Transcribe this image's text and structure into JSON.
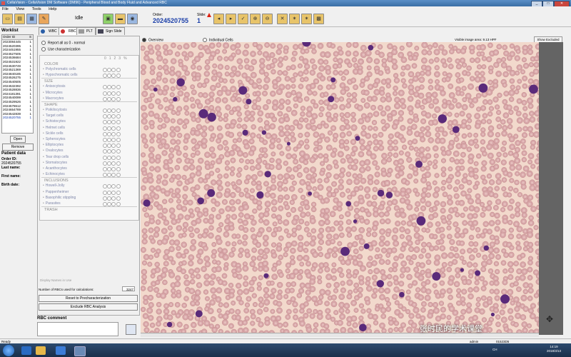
{
  "window": {
    "title": "CellaVision - CellaVision DM Software (DM96) - Peripheral Blood and Body Fluid and Advanced RBC",
    "minimize": "_",
    "maximize": "□",
    "close": "✕"
  },
  "menu": [
    "File",
    "View",
    "Tools",
    "Help"
  ],
  "toolbar": {
    "status": "Idle",
    "order_label": "Order:",
    "order_value": "2024520755",
    "slide_label": "Slide:",
    "slide_value": "1"
  },
  "worklist": {
    "title": "Worklist",
    "col_order": "Order ID",
    "col_s": "S",
    "rows": [
      {
        "id": "2023084445",
        "s": "1"
      },
      {
        "id": "2024520395",
        "s": "1"
      },
      {
        "id": "2024451955",
        "s": "1"
      },
      {
        "id": "2024527505",
        "s": "1"
      },
      {
        "id": "2024536684",
        "s": "1"
      },
      {
        "id": "2024531922",
        "s": "1"
      },
      {
        "id": "2024530749",
        "s": "1"
      },
      {
        "id": "2024521369",
        "s": "1"
      },
      {
        "id": "2024840185",
        "s": "1"
      },
      {
        "id": "2024526275",
        "s": "1"
      },
      {
        "id": "2024540505",
        "s": "1"
      },
      {
        "id": "2024532392",
        "s": "1"
      },
      {
        "id": "2024528836",
        "s": "1"
      },
      {
        "id": "2024181391",
        "s": "1"
      },
      {
        "id": "2024540099",
        "s": "1"
      },
      {
        "id": "2024529526",
        "s": "1"
      },
      {
        "id": "2024578612",
        "s": "1"
      },
      {
        "id": "2024654789",
        "s": "1"
      },
      {
        "id": "2024542839",
        "s": "1"
      },
      {
        "id": "2024520755",
        "s": "1"
      }
    ],
    "open_label": "Open",
    "remove_label": "Remove"
  },
  "patient": {
    "title": "Patient data",
    "order_id_label": "Order ID:",
    "order_id_value": "2024520755",
    "last_name_label": "Last name:",
    "first_name_label": "First name:",
    "birth_date_label": "Birth date:"
  },
  "tabs": [
    "WBC",
    "RBC",
    "PLT",
    "Sign Slide"
  ],
  "rbc": {
    "report_all_normal": "Report all as 0 - normal",
    "use_characterization": "Use characterization",
    "grade_header": "0 1 2 3 %",
    "categories": [
      {
        "name": "COLOR",
        "items": [
          "Polychromatic cells",
          "Hypochromatic cells"
        ]
      },
      {
        "name": "SIZE",
        "items": [
          "Anisocytosis",
          "Microcytes",
          "Macrocytes"
        ]
      },
      {
        "name": "SHAPE",
        "items": [
          "Poikilocytosis",
          "Target cells",
          "Schistocytes",
          "Helmet cells",
          "Sickle cells",
          "Spherocytes",
          "Elliptocytes",
          "Ovalocytes",
          "Tear drop cells",
          "Stomatocytes",
          "Acanthocytes",
          "Echinocytes"
        ]
      },
      {
        "name": "INCLUSIONS",
        "items": [
          "Howell-Jolly",
          "Pappenheimer",
          "Basophilic stippling",
          "Parasites"
        ]
      },
      {
        "name": "TRASH",
        "items": []
      }
    ],
    "display_names": "Display Names in Use",
    "count_label": "Number of RBCs used for calculations:",
    "count_value": "3247",
    "reset_label": "Reset to Precharacterization",
    "exclude_label": "Exclude RBC Analysis",
    "comment_title": "RBC comment"
  },
  "view": {
    "overview_label": "Overview",
    "individual_label": "Individual Cells",
    "visible_area": "Visible image area: 9.13 HPF",
    "show_excluded": "Show Excluded"
  },
  "statusbar": {
    "status": "Ready",
    "user": "admin",
    "id": "01523D5"
  },
  "taskbar": {
    "time": "14:19",
    "date": "2018/3/13",
    "tray": "CH"
  },
  "watermark": "张时民的学术课堂",
  "colors": {
    "accent_blue": "#1a3ea8",
    "smear_background": "#f2d9cc",
    "rbc_color": "#d7a6a8",
    "wbc_color": "#5a2a7a"
  }
}
